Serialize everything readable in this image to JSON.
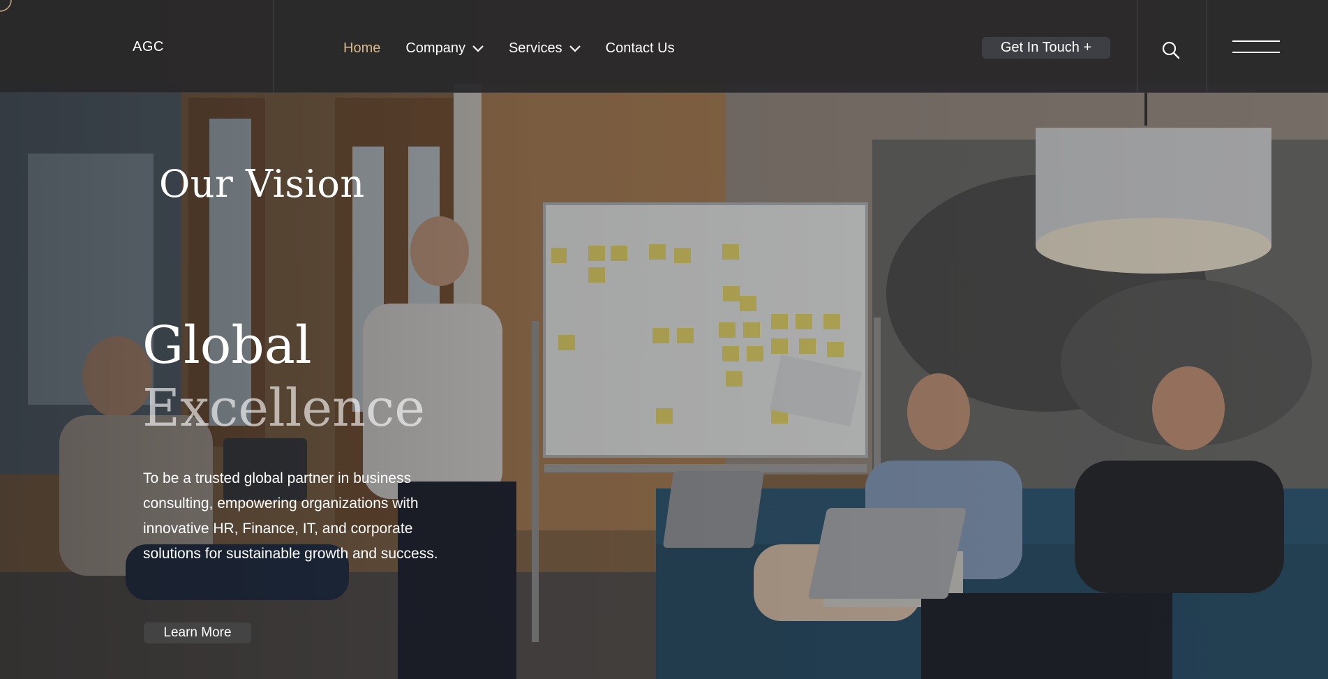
{
  "header": {
    "logo": "AGC",
    "nav": [
      {
        "label": "Home",
        "active": true,
        "has_dropdown": false
      },
      {
        "label": "Company",
        "active": false,
        "has_dropdown": true
      },
      {
        "label": "Services",
        "active": false,
        "has_dropdown": true
      },
      {
        "label": "Contact Us",
        "active": false,
        "has_dropdown": false
      }
    ],
    "cta_label": "Get In Touch +",
    "search_icon": "search-icon",
    "menu_icon": "hamburger-menu-icon"
  },
  "hero": {
    "eyebrow": "Our Vision",
    "headline_line1": "Global",
    "headline_line2": "Excellence",
    "description": "To be a trusted global partner in business consulting, empowering organizations with innovative HR, Finance, IT, and corporate solutions for sustainable growth and success.",
    "button_label": "Learn More",
    "background": "office-team-meeting-photo"
  },
  "colors": {
    "header_bg": "#28282a",
    "active_nav": "#d9b88a",
    "text": "#ffffff",
    "cta_bg": "#3d3f44"
  }
}
